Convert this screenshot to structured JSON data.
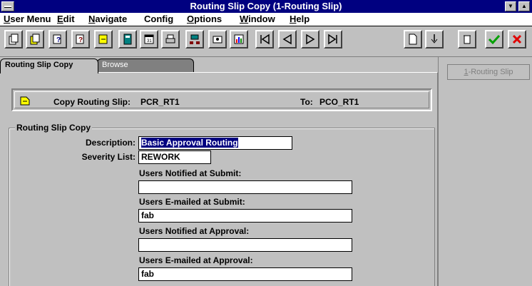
{
  "window": {
    "title": "Routing Slip Copy (1-Routing Slip)"
  },
  "menu": [
    {
      "label": "User Menu",
      "mnemonic": "U"
    },
    {
      "label": "Edit",
      "mnemonic": "E"
    },
    {
      "label": "Navigate",
      "mnemonic": "N"
    },
    {
      "label": "Config",
      "mnemonic": "g"
    },
    {
      "label": "Options",
      "mnemonic": "O"
    },
    {
      "label": "Window",
      "mnemonic": "W"
    },
    {
      "label": "Help",
      "mnemonic": "H"
    }
  ],
  "toolbar": {
    "icons": [
      "copy-document-icon",
      "copy-record-icon",
      "query-icon",
      "query-edit-icon",
      "query-run-icon",
      "calculator-icon",
      "calendar-icon",
      "print-icon",
      "network-icon",
      "clipboard-icon",
      "chart-icon",
      "first-record-icon",
      "previous-record-icon",
      "next-record-icon",
      "last-record-icon",
      "new-record-icon",
      "insert-record-icon",
      "delete-record-icon",
      "accept-icon",
      "cancel-icon"
    ],
    "accept_color": "#00a000",
    "cancel_color": "#e00000"
  },
  "tabs": {
    "active": "Routing Slip Copy",
    "inactive": "Browse"
  },
  "right_panel": {
    "button_label": "1-Routing Slip"
  },
  "header": {
    "copy_label": "Copy Routing Slip:",
    "copy_value": "PCR_RT1",
    "to_label": "To:",
    "to_value": "PCO_RT1"
  },
  "form": {
    "group_title": "Routing Slip Copy",
    "description_label": "Description:",
    "description_value": "Basic Approval Routing",
    "severity_label": "Severity List:",
    "severity_value": "REWORK",
    "notified_submit_label": "Users Notified at Submit:",
    "notified_submit_value": "",
    "emailed_submit_label": "Users E-mailed at Submit:",
    "emailed_submit_value": "fab",
    "notified_approval_label": "Users Notified at Approval:",
    "notified_approval_value": "",
    "emailed_approval_label": "Users E-mailed at Approval:",
    "emailed_approval_value": "fab"
  }
}
